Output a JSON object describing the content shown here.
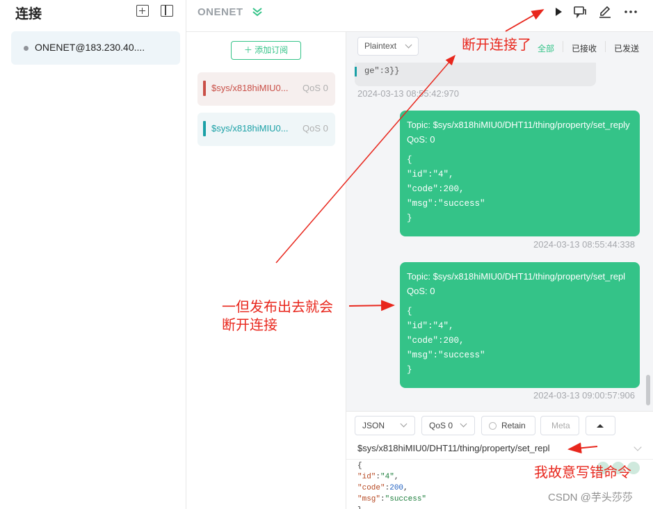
{
  "sidebar": {
    "title": "连接",
    "connections": [
      {
        "name": "ONENET@183.230.40....",
        "status_color": "#909399"
      }
    ]
  },
  "header": {
    "connection_name": "ONENET",
    "icons": [
      "chevrons-down-icon",
      "play-icon",
      "message-icon",
      "edit-icon",
      "more-icon"
    ]
  },
  "subscriptions": {
    "add_label": "添加订阅",
    "items": [
      {
        "topic": "$sys/x818hiMIU0...",
        "qos": "QoS 0",
        "color": "#c94f47"
      },
      {
        "topic": "$sys/x818hiMIU0...",
        "qos": "QoS 0",
        "color": "#1aa0a6"
      }
    ]
  },
  "messages": {
    "format": "Plaintext",
    "filters": [
      "全部",
      "已接收",
      "已发送"
    ],
    "active_filter": "全部",
    "partial_received_text": "ge\":3}}",
    "list": [
      {
        "timestamp": "2024-03-13 08:55:42:970"
      },
      {
        "head": "Topic: $sys/x818hiMIU0/DHT11/thing/property/set_reply    QoS: 0",
        "payload": "{\n\"id\":\"4\",\n\"code\":200,\n\"msg\":\"success\"\n}",
        "timestamp": "2024-03-13 08:55:44:338"
      },
      {
        "head": "Topic: $sys/x818hiMIU0/DHT11/thing/property/set_repl    QoS: 0",
        "payload": "{\n\"id\":\"4\",\n\"code\":200,\n\"msg\":\"success\"\n}",
        "timestamp": "2024-03-13 09:00:57:906"
      }
    ],
    "bubble_color": "#34c388"
  },
  "publish": {
    "payload_format": "JSON",
    "qos": "QoS 0",
    "retain_label": "Retain",
    "meta_label": "Meta",
    "topic": "$sys/x818hiMIU0/DHT11/thing/property/set_repl",
    "payload_lines": {
      "l1": "{",
      "l2k": "\"id\"",
      "l2v": "\"4\"",
      "l3k": "\"code\"",
      "l3v": "200",
      "l4k": "\"msg\"",
      "l4v": "\"success\"",
      "l5": "}"
    }
  },
  "annotations": {
    "disconnected": "断开连接了",
    "publish_disconnects_1": "一但发布出去就会",
    "publish_disconnects_2": "断开连接",
    "wrong_command": "我故意写错命令",
    "color": "#e8271d"
  },
  "watermark": "CSDN @芋头莎莎"
}
